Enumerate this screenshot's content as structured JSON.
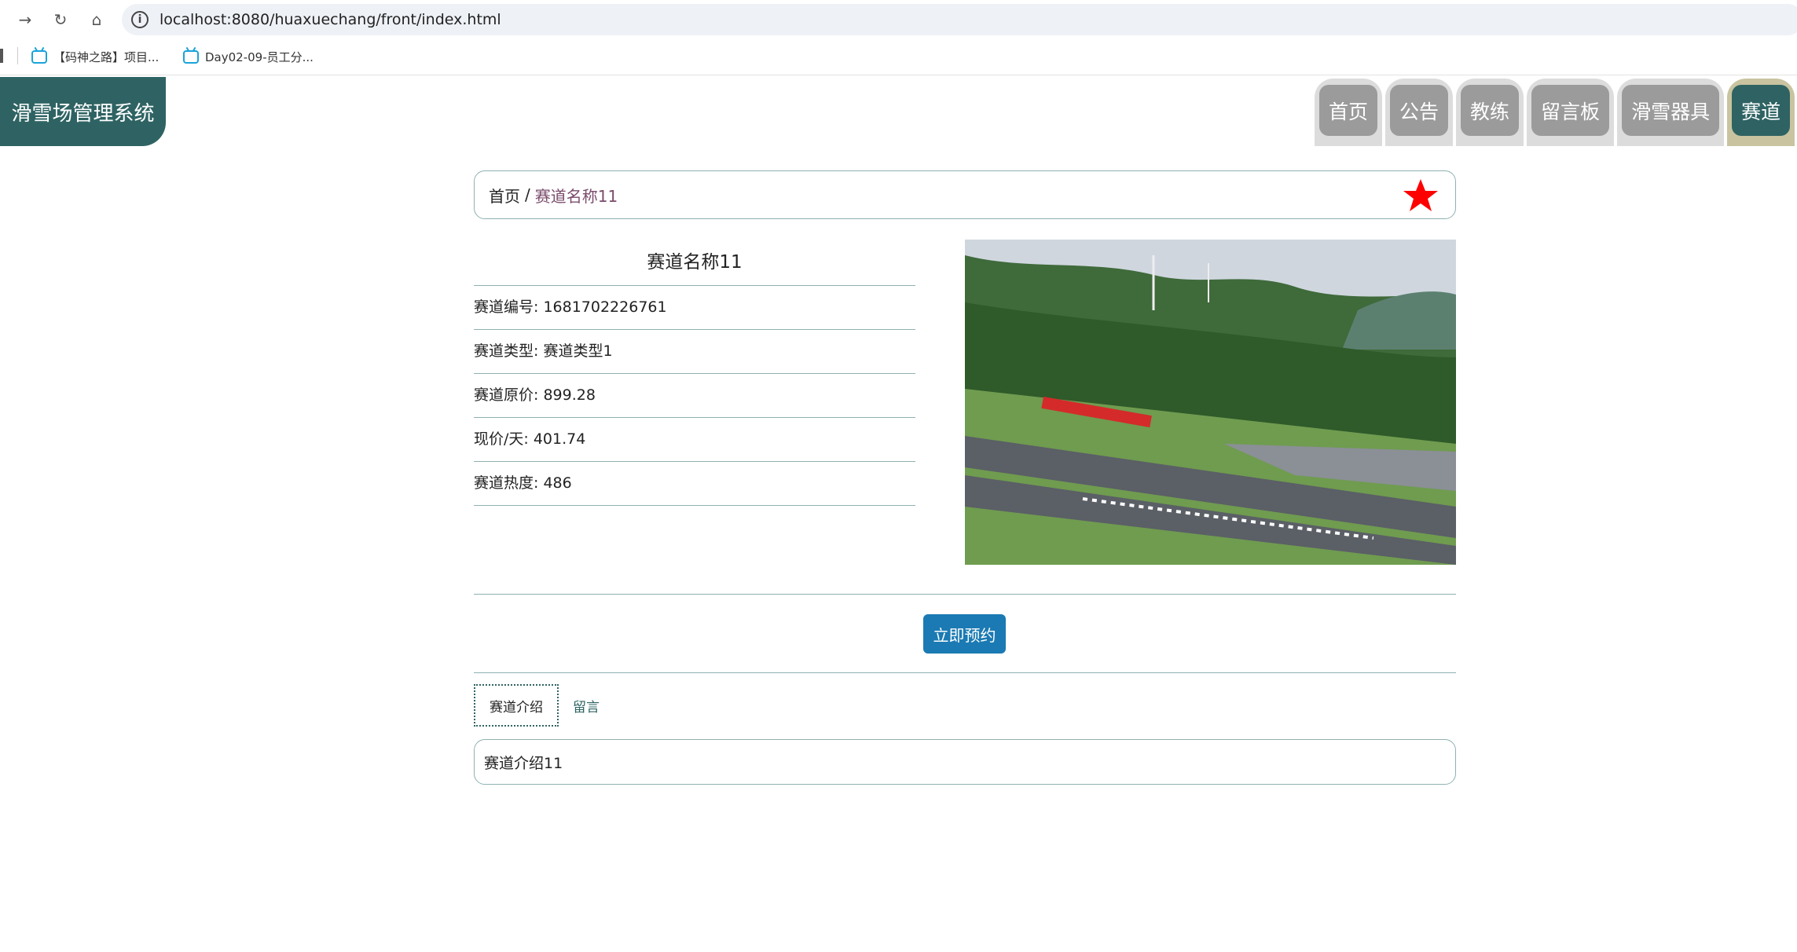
{
  "browser": {
    "url": "localhost:8080/huaxuechang/front/index.html",
    "bookmarks": [
      {
        "label": "【码神之路】项目..."
      },
      {
        "label": "Day02-09-员工分..."
      }
    ]
  },
  "site": {
    "logo_text": "滑雪场管理系统",
    "nav": [
      "首页",
      "公告",
      "教练",
      "留言板",
      "滑雪器具",
      "赛道"
    ]
  },
  "breadcrumb": {
    "home": "首页",
    "separator": "/",
    "current": "赛道名称11"
  },
  "detail": {
    "title": "赛道名称11",
    "fields": [
      {
        "label": "赛道编号: 1681702226761"
      },
      {
        "label": "赛道类型: 赛道类型1"
      },
      {
        "label": "赛道原价: 899.28"
      },
      {
        "label": "现价/天: 401.74"
      },
      {
        "label": "赛道热度: 486"
      }
    ]
  },
  "actions": {
    "book_label": "立即预约"
  },
  "tabs": {
    "items": [
      "赛道介绍",
      "留言"
    ],
    "active_index": 0
  },
  "intro": {
    "text": "赛道介绍11"
  },
  "colors": {
    "brand": "#2f6363",
    "button": "#1b7ab3",
    "star": "#ff0000",
    "border": "#8fb1b1"
  }
}
